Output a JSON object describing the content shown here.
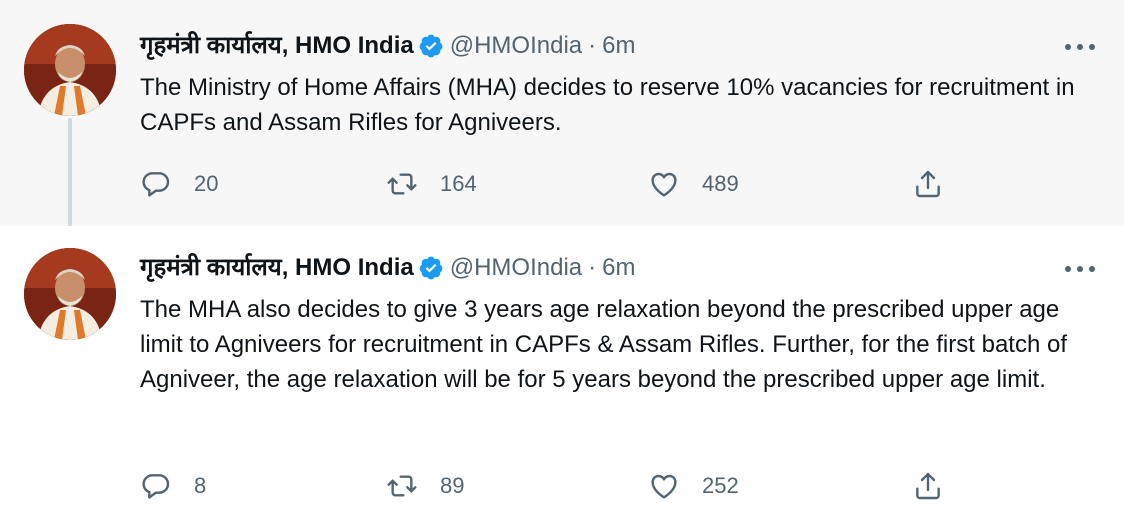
{
  "tweets": [
    {
      "author_name": "गृहमंत्री कार्यालय, HMO India",
      "handle": "@HMOIndia",
      "separator": "·",
      "time": "6m",
      "text": "The Ministry of Home Affairs (MHA) decides to reserve 10% vacancies for recruitment in CAPFs and Assam Rifles for Agniveers.",
      "replies": "20",
      "retweets": "164",
      "likes": "489"
    },
    {
      "author_name": "गृहमंत्री कार्यालय, HMO India",
      "handle": "@HMOIndia",
      "separator": "·",
      "time": "6m",
      "text": "The MHA also decides to give 3 years age relaxation beyond the prescribed upper age limit to Agniveers for recruitment in CAPFs & Assam Rifles. Further, for the first batch of Agniveer, the age relaxation will be for 5 years beyond the prescribed upper age limit.",
      "replies": "8",
      "retweets": "89",
      "likes": "252"
    }
  ],
  "icons": {
    "verified": "verified-badge-icon",
    "more": "more-options-icon",
    "reply": "reply-icon",
    "retweet": "retweet-icon",
    "like": "like-icon",
    "share": "share-icon"
  },
  "colors": {
    "verified_blue": "#1d9bf0",
    "text_primary": "#0f1419",
    "text_secondary": "#536471",
    "thread_line": "#cfd9de",
    "first_tweet_bg": "#f7f7f7"
  }
}
